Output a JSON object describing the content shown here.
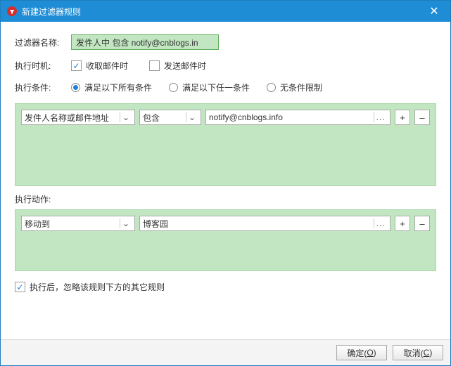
{
  "title": "新建过滤器规则",
  "labels": {
    "filter_name": "过滤器名称:",
    "run_time": "执行时机:",
    "run_cond": "执行条件:",
    "run_action": "执行动作:"
  },
  "filter_name_value": "发件人中 包含 notify@cnblogs.in",
  "run_time": {
    "receive": {
      "label": "收取邮件时",
      "checked": true
    },
    "send": {
      "label": "发送邮件时",
      "checked": false
    }
  },
  "run_cond": {
    "all": {
      "label": "满足以下所有条件",
      "selected": true
    },
    "any": {
      "label": "满足以下任一条件",
      "selected": false
    },
    "none": {
      "label": "无条件限制",
      "selected": false
    }
  },
  "condition_row": {
    "field": "发件人名称或邮件地址",
    "operator": "包含",
    "value": "notify@cnblogs.info"
  },
  "action_row": {
    "action": "移动到",
    "target": "博客园"
  },
  "ignore_below": {
    "label": "执行后，忽略该规则下方的其它规则",
    "checked": true
  },
  "buttons": {
    "ok_pre": "确定(",
    "ok_key": "O",
    "ok_post": ")",
    "cancel_pre": "取消(",
    "cancel_key": "C",
    "cancel_post": ")",
    "plus": "+",
    "minus": "–",
    "dots": "...",
    "dd": "⌄"
  }
}
